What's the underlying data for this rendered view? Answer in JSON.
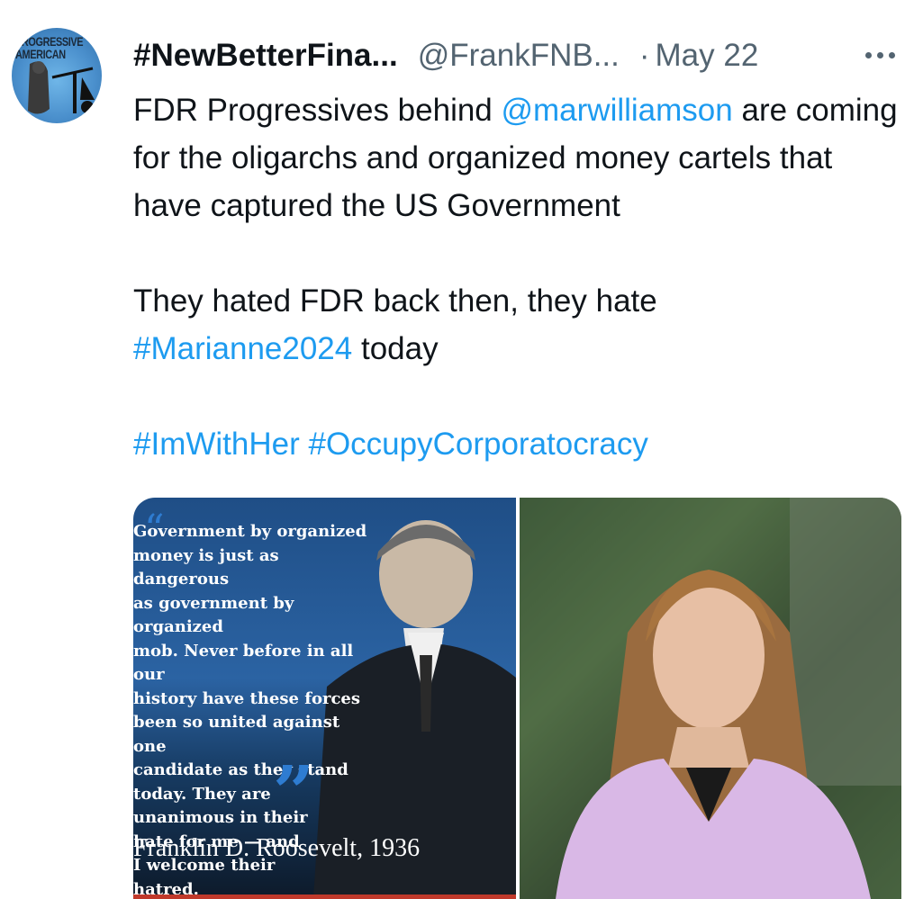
{
  "avatar": {
    "logo_text": "PROGRESSIVE AMERICAN"
  },
  "header": {
    "display_name": "#NewBetterFina...",
    "handle": "@FrankFNB...",
    "separator": "·",
    "date": "May 22"
  },
  "tweet": {
    "line1_prefix": "FDR Progressives behind ",
    "mention": "@marwilliamson",
    "line1_suffix": " are coming for the oligarchs and organized money cartels that have captured the US Government",
    "line2_prefix": "They hated FDR back then, they hate ",
    "hashtag1": "#Marianne2024",
    "line2_suffix": " today",
    "hashtag2": "#ImWithHer",
    "hashtag3": "#OccupyCorporatocracy"
  },
  "media": {
    "quote": "Government by organized\nmoney is just as dangerous\nas government by organized\nmob. Never before in all our\nhistory have these forces\nbeen so united against one\ncandidate as they stand\ntoday. They are\nunanimous in their\nhate for me — and\nI welcome their\nhatred.",
    "attribution": "Franklin D. Roosevelt, 1936"
  },
  "colors": {
    "link": "#1d9bf0",
    "secondary": "#536471",
    "text": "#0f1419"
  }
}
